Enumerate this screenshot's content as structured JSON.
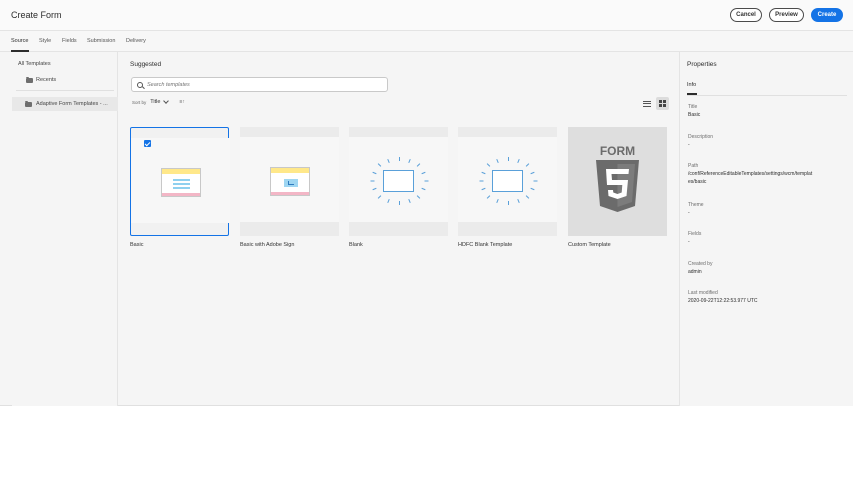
{
  "header": {
    "title": "Create Form",
    "cancel_label": "Cancel",
    "preview_label": "Preview",
    "create_label": "Create"
  },
  "tabs": [
    {
      "label": "Source",
      "active": true
    },
    {
      "label": "Style",
      "active": false
    },
    {
      "label": "Fields",
      "active": false
    },
    {
      "label": "Submission",
      "active": false
    },
    {
      "label": "Delivery",
      "active": false
    }
  ],
  "sidebar": {
    "title": "All Templates",
    "recents_label": "Recents",
    "items": [
      {
        "label": "Adaptive Form Templates - ...",
        "icon": "folder-icon",
        "selected": true
      }
    ]
  },
  "main": {
    "section_title": "Suggested",
    "search_placeholder": "Search templates",
    "sort_label": "Sort by",
    "sort_value": "Title",
    "sort_order_glyph": "≡↑",
    "templates": [
      {
        "name": "Basic",
        "thumbnail": "form-thumbnail",
        "selected": true
      },
      {
        "name": "Basic with Adobe Sign",
        "thumbnail": "form-sign-thumbnail",
        "selected": false
      },
      {
        "name": "Blank",
        "thumbnail": "blank-thumbnail",
        "selected": false
      },
      {
        "name": "HDFC Blank Template",
        "thumbnail": "blank-thumbnail",
        "selected": false
      },
      {
        "name": "Custom Template",
        "thumbnail": "html5-form-thumbnail",
        "selected": false
      }
    ],
    "html5_badge_text": "FORM"
  },
  "properties": {
    "panel_title": "Properties",
    "tab_label": "Info",
    "fields": [
      {
        "label": "Title",
        "value": "Basic"
      },
      {
        "label": "Description",
        "value": "-"
      },
      {
        "label": "Path",
        "value": "/conf/ReferenceEditableTemplates/settings/wcm/templates/basic"
      },
      {
        "label": "Theme",
        "value": "-"
      },
      {
        "label": "Fields",
        "value": "-"
      },
      {
        "label": "Created by",
        "value": "admin"
      },
      {
        "label": "Last modified",
        "value": "2020-09-22T12:22:53.977 UTC"
      }
    ]
  },
  "colors": {
    "accent": "#1473e6",
    "selection_border": "#1473e6",
    "html5_badge": "#6b6b6b"
  }
}
